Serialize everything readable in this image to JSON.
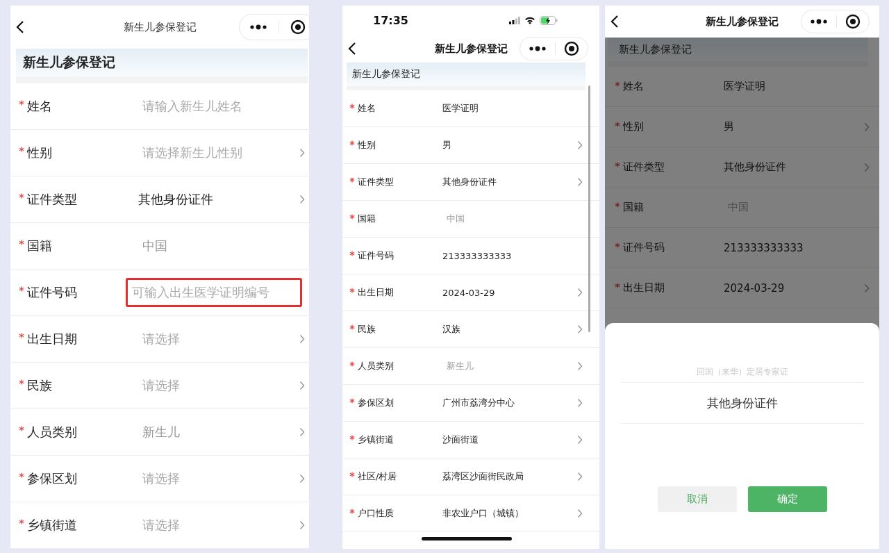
{
  "panels": [
    {
      "nav_title": "新生儿参保登记",
      "section_title": "新生儿参保登记",
      "fields": [
        {
          "label": "姓名",
          "required": true,
          "placeholder": "请输入新生儿姓名",
          "readonly": false,
          "arrow": false,
          "highlighted": false
        },
        {
          "label": "性别",
          "required": true,
          "placeholder": "请选择新生儿性别",
          "readonly": false,
          "arrow": true,
          "highlighted": false
        },
        {
          "label": "证件类型",
          "required": true,
          "value": "其他身份证件",
          "readonly": false,
          "arrow": true,
          "highlighted": false
        },
        {
          "label": "国籍",
          "required": true,
          "value": "中国",
          "readonly": true,
          "arrow": false,
          "highlighted": false
        },
        {
          "label": "证件号码",
          "required": true,
          "placeholder": "可输入出生医学证明编号",
          "readonly": false,
          "arrow": false,
          "highlighted": true
        },
        {
          "label": "出生日期",
          "required": true,
          "placeholder": "请选择",
          "readonly": false,
          "arrow": true,
          "highlighted": false
        },
        {
          "label": "民族",
          "required": true,
          "placeholder": "请选择",
          "readonly": false,
          "arrow": true,
          "highlighted": false
        },
        {
          "label": "人员类别",
          "required": true,
          "value": "新生儿",
          "readonly": true,
          "arrow": true,
          "highlighted": false
        },
        {
          "label": "参保区划",
          "required": true,
          "placeholder": "请选择",
          "readonly": false,
          "arrow": true,
          "highlighted": false
        },
        {
          "label": "乡镇街道",
          "required": true,
          "placeholder": "请选择",
          "readonly": false,
          "arrow": true,
          "highlighted": false
        }
      ]
    },
    {
      "status_bar": {
        "time": "17:35"
      },
      "nav_title": "新生儿参保登记",
      "section_title": "新生儿参保登记",
      "fields": [
        {
          "label": "姓名",
          "required": true,
          "value": "医学证明",
          "readonly": false,
          "arrow": false,
          "highlighted": false
        },
        {
          "label": "性别",
          "required": true,
          "value": "男",
          "readonly": false,
          "arrow": true,
          "highlighted": false
        },
        {
          "label": "证件类型",
          "required": true,
          "value": "其他身份证件",
          "readonly": false,
          "arrow": true,
          "highlighted": false
        },
        {
          "label": "国籍",
          "required": true,
          "value": "中国",
          "readonly": true,
          "arrow": false,
          "highlighted": false
        },
        {
          "label": "证件号码",
          "required": true,
          "value": "213333333333",
          "readonly": false,
          "arrow": false,
          "highlighted": false
        },
        {
          "label": "出生日期",
          "required": true,
          "value": "2024-03-29",
          "readonly": false,
          "arrow": true,
          "highlighted": false
        },
        {
          "label": "民族",
          "required": true,
          "value": "汉族",
          "readonly": false,
          "arrow": true,
          "highlighted": false
        },
        {
          "label": "人员类别",
          "required": true,
          "value": "新生儿",
          "readonly": true,
          "arrow": true,
          "highlighted": false
        },
        {
          "label": "参保区划",
          "required": true,
          "value": "广州市荔湾分中心",
          "readonly": false,
          "arrow": true,
          "highlighted": false
        },
        {
          "label": "乡镇街道",
          "required": true,
          "value": "沙面街道",
          "readonly": false,
          "arrow": true,
          "highlighted": false
        },
        {
          "label": "社区/村居",
          "required": true,
          "value": "荔湾区沙面街民政局",
          "readonly": false,
          "arrow": true,
          "highlighted": false
        },
        {
          "label": "户口性质",
          "required": true,
          "value": "非农业户口（城镇）",
          "readonly": false,
          "arrow": true,
          "highlighted": false
        }
      ]
    },
    {
      "nav_title": "新生儿参保登记",
      "section_title": "新生儿参保登记",
      "fields": [
        {
          "label": "姓名",
          "required": true,
          "value": "医学证明",
          "readonly": false,
          "arrow": false,
          "highlighted": false
        },
        {
          "label": "性别",
          "required": true,
          "value": "男",
          "readonly": false,
          "arrow": true,
          "highlighted": false
        },
        {
          "label": "证件类型",
          "required": true,
          "value": "其他身份证件",
          "readonly": false,
          "arrow": true,
          "highlighted": false
        },
        {
          "label": "国籍",
          "required": true,
          "value": "中国",
          "readonly": true,
          "arrow": false,
          "highlighted": false
        },
        {
          "label": "证件号码",
          "required": true,
          "value": "213333333333",
          "readonly": false,
          "arrow": false,
          "highlighted": false
        },
        {
          "label": "出生日期",
          "required": true,
          "value": "2024-03-29",
          "readonly": false,
          "arrow": true,
          "highlighted": false
        }
      ],
      "picker": {
        "options": [
          {
            "label": "回国（来华）定居专家证",
            "selected": false
          },
          {
            "label": "其他身份证件",
            "selected": true
          }
        ],
        "buttons": [
          {
            "label": "取消",
            "kind": "cancel"
          },
          {
            "label": "确定",
            "kind": "confirm"
          }
        ]
      }
    }
  ]
}
